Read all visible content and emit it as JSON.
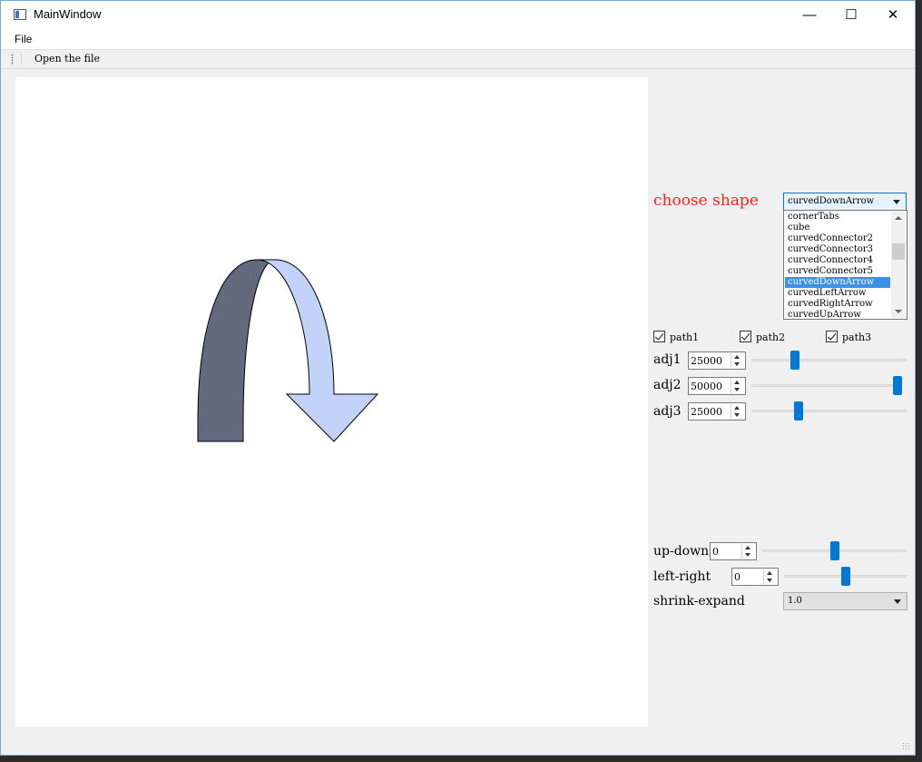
{
  "window": {
    "title": "MainWindow",
    "controls": {
      "minimize": "—",
      "maximize": "☐",
      "close": "✕"
    }
  },
  "menu": {
    "file": "File"
  },
  "toolbar": {
    "open": "Open the file"
  },
  "shape_select": {
    "label": "choose shape",
    "selected": "curvedDownArrow",
    "options": [
      "cornerTabs",
      "cube",
      "curvedConnector2",
      "curvedConnector3",
      "curvedConnector4",
      "curvedConnector5",
      "curvedDownArrow",
      "curvedLeftArrow",
      "curvedRightArrow",
      "curvedUpArrow"
    ],
    "selected_index": 6
  },
  "paths": [
    {
      "label": "path1",
      "checked": true
    },
    {
      "label": "path2",
      "checked": true
    },
    {
      "label": "path3",
      "checked": true
    }
  ],
  "adjusts": [
    {
      "label": "adj1",
      "value": "25000",
      "fraction": 0.27
    },
    {
      "label": "adj2",
      "value": "50000",
      "fraction": 1.0
    },
    {
      "label": "adj3",
      "value": "25000",
      "fraction": 0.29
    }
  ],
  "transforms": {
    "up_down": {
      "label": "up-down",
      "value": "0",
      "fraction": 0.5
    },
    "left_right": {
      "label": "left-right",
      "value": "0",
      "fraction": 0.5
    },
    "shrink_expand": {
      "label": "shrink-expand",
      "value": "1.0"
    }
  },
  "colors": {
    "arrow_dark": "#636a7e",
    "arrow_light": "#c2d2f8",
    "accent": "#0078d7",
    "label_red": "#ff2020"
  }
}
